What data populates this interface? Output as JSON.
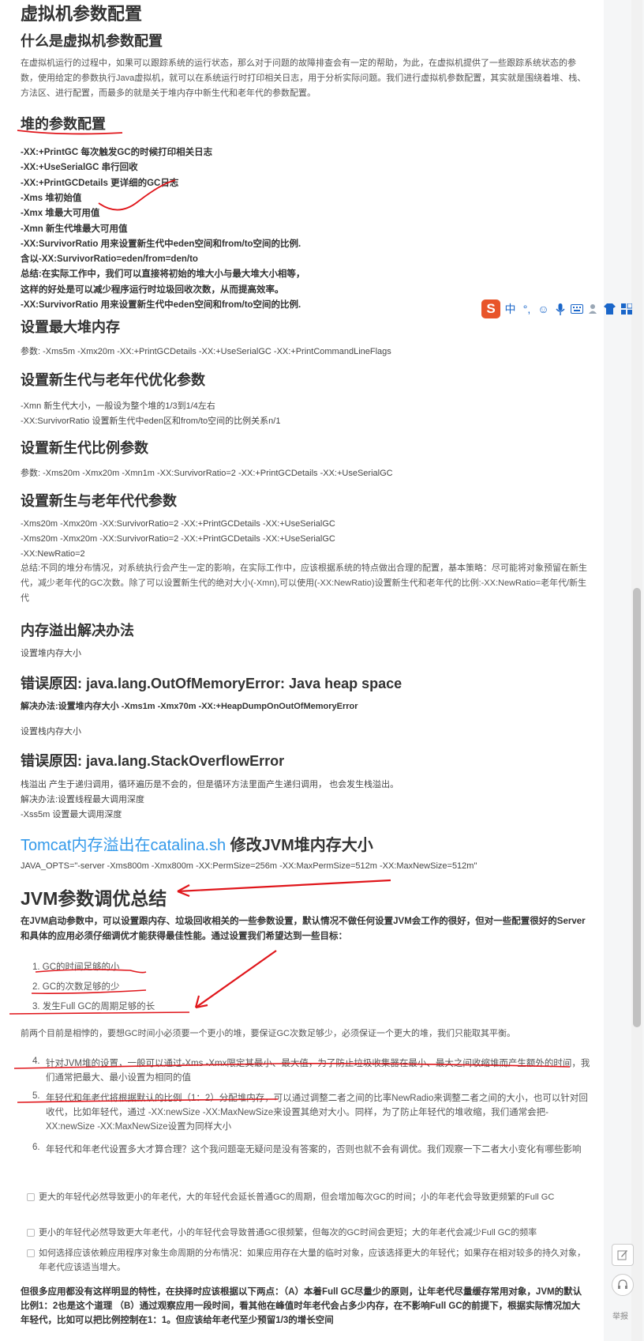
{
  "article": {
    "title": "虚拟机参数配置",
    "what_heading": "什么是虚拟机参数配置",
    "what_para": "在虚拟机运行的过程中，如果可以跟踪系统的运行状态，那么对于问题的故障排查会有一定的帮助，为此，在虚拟机提供了一些跟踪系统状态的参数，使用给定的参数执行Java虚拟机，就可以在系统运行时打印相关日志，用于分析实际问题。我们进行虚拟机参数配置，其实就是围绕着堆、栈、方法区、进行配置，而最多的就是关于堆内存中新生代和老年代的参数配置。",
    "heap_heading": "堆的参数配置",
    "heap_lines": [
      "-XX:+PrintGC 每次触发GC的时候打印相关日志",
      "-XX:+UseSerialGC 串行回收",
      "-XX:+PrintGCDetails 更详细的GC日志",
      "-Xms 堆初始值",
      "-Xmx 堆最大可用值",
      "-Xmn 新生代堆最大可用值",
      "-XX:SurvivorRatio 用来设置新生代中eden空间和from/to空间的比例.",
      "含以-XX:SurvivorRatio=eden/from=den/to",
      "总结:在实际工作中，我们可以直接将初始的堆大小与最大堆大小相等，",
      "这样的好处是可以减少程序运行时垃圾回收次数，从而提高效率。",
      "-XX:SurvivorRatio 用来设置新生代中eden空间和from/to空间的比例."
    ],
    "maxheap_heading": "设置最大堆内存",
    "maxheap_line": "参数: -Xms5m -Xmx20m -XX:+PrintGCDetails -XX:+UseSerialGC -XX:+PrintCommandLineFlags",
    "young_old_heading": "设置新生代与老年代优化参数",
    "young_old_lines": [
      "-Xmn 新生代大小，一般设为整个堆的1/3到1/4左右",
      "-XX:SurvivorRatio 设置新生代中eden区和from/to空间的比例关系n/1"
    ],
    "young_ratio_heading": "设置新生代比例参数",
    "young_ratio_line": "参数: -Xms20m -Xmx20m -Xmn1m -XX:SurvivorRatio=2 -XX:+PrintGCDetails -XX:+UseSerialGC",
    "new_old_heading": "设置新生与老年代代参数",
    "new_old_lines": [
      "-Xms20m -Xmx20m -XX:SurvivorRatio=2 -XX:+PrintGCDetails -XX:+UseSerialGC",
      "-Xms20m -Xmx20m -XX:SurvivorRatio=2 -XX:+PrintGCDetails -XX:+UseSerialGC",
      "-XX:NewRatio=2"
    ],
    "new_old_summary": "总结:不同的堆分布情况，对系统执行会产生一定的影响，在实际工作中，应该根据系统的特点做出合理的配置，基本策略：尽可能将对象预留在新生代，减少老年代的GC次数。除了可以设置新生代的绝对大小(-Xmn),可以使用(-XX:NewRatio)设置新生代和老年代的比例:-XX:NewRatio=老年代/新生代",
    "oom_heading": "内存溢出解决办法",
    "oom_sub1": "设置堆内存大小",
    "oom_err1": "错误原因: java.lang.OutOfMemoryError: Java heap space",
    "oom_fix1": "解决办法:设置堆内存大小 -Xms1m -Xmx70m -XX:+HeapDumpOnOutOfMemoryError",
    "oom_sub2": "设置栈内存大小",
    "oom_err2": "错误原因: java.lang.StackOverflowError",
    "stack_lines": [
      "栈溢出 产生于递归调用，循环遍历是不会的，但是循环方法里面产生递归调用， 也会发生栈溢出。",
      "解决办法:设置线程最大调用深度",
      "-Xss5m 设置最大调用深度"
    ],
    "tomcat_link": "Tomcat内存溢出在catalina.sh",
    "tomcat_rest": " 修改JVM堆内存大小",
    "tomcat_line": "JAVA_OPTS=\"-server -Xms800m -Xmx800m -XX:PermSize=256m -XX:MaxPermSize=512m -XX:MaxNewSize=512m\"",
    "tuning_heading": "JVM参数调优总结",
    "tuning_intro": "在JVM启动参数中，可以设置跟内存、垃圾回收相关的一些参数设置，默认情况不做任何设置JVM会工作的很好，但对一些配置很好的Server和具体的应用必须仔细调优才能获得最佳性能。通过设置我们希望达到一些目标：",
    "goals": [
      "1.  GC的时间足够的小",
      "2.  GC的次数足够的少",
      "3.  发生Full GC的周期足够的长"
    ],
    "contradiction": "前两个目前是相悖的，要想GC时间小必须要一个更小的堆，要保证GC次数足够少，必须保证一个更大的堆，我们只能取其平衡。",
    "items": [
      {
        "num": "4.",
        "text": "针对JVM堆的设置，一般可以通过-Xms -Xmx限定其最小、最大值，为了防止垃圾收集器在最小、最大之间收缩堆而产生额外的时间，我们通常把最大、最小设置为相同的值"
      },
      {
        "num": "5.",
        "text": "年轻代和年老代将根据默认的比例（1：2）分配堆内存，可以通过调整二者之间的比率NewRadio来调整二者之间的大小，也可以针对回收代，比如年轻代，通过 -XX:newSize -XX:MaxNewSize来设置其绝对大小。同样，为了防止年轻代的堆收缩，我们通常会把-XX:newSize -XX:MaxNewSize设置为同样大小"
      },
      {
        "num": "6.",
        "text": "年轻代和年老代设置多大才算合理？这个我问题毫无疑问是没有答案的，否则也就不会有调优。我们观察一下二者大小变化有哪些影响"
      }
    ],
    "bullets": [
      "更大的年轻代必然导致更小的年老代，大的年轻代会延长普通GC的周期，但会增加每次GC的时间；小的年老代会导致更频繁的Full GC",
      "更小的年轻代必然导致更大年老代，小的年轻代会导致普通GC很频繁，但每次的GC时间会更短；大的年老代会减少Full GC的频率",
      "如何选择应该依赖应用程序对象生命周期的分布情况：如果应用存在大量的临时对象，应该选择更大的年轻代；如果存在相对较多的持久对象，年老代应该适当增大。"
    ],
    "final_para": "但很多应用都没有这样明显的特性，在抉择时应该根据以下两点：（A）本着Full GC尽量少的原则，让年老代尽量缓存常用对象，JVM的默认比例1：2也是这个道理 （B）通过观察应用一段时间，看其他在峰值时年老代会占多少内存，在不影响Full GC的前提下，根据实际情况加大年轻代，比如可以把比例控制在1：1。但应该给年老代至少预留1/3的增长空间"
  },
  "ime_toolbar": {
    "logo": "S",
    "icons": [
      "中",
      "°,",
      "☺",
      "mic-icon",
      "keyboard-icon",
      "user-icon",
      "shirt-icon",
      "grid-icon"
    ]
  },
  "sidebar": {
    "report_label": "举报"
  },
  "colors": {
    "annotation_red": "#e0161b",
    "link_blue": "#3399ea",
    "ime_orange": "#e8552a"
  }
}
